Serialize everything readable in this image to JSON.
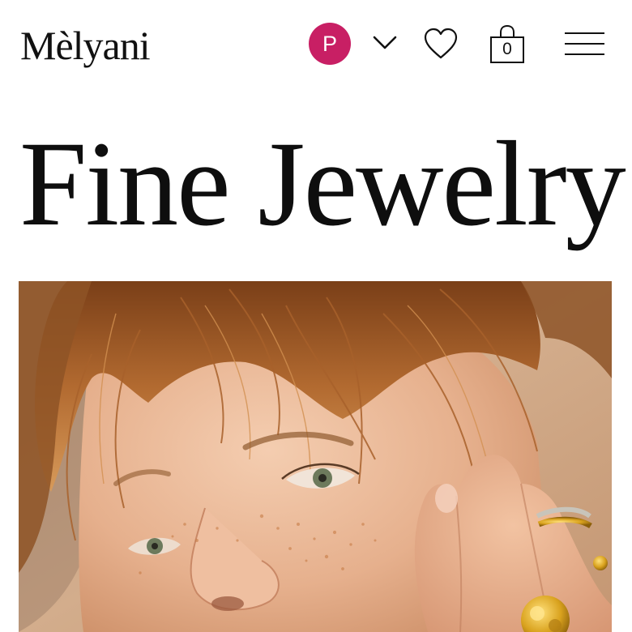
{
  "header": {
    "brand": "Mèlyani",
    "account": {
      "initial": "P",
      "avatar_color": "#c81f64",
      "menu_icon": "chevron-down-icon"
    },
    "wishlist_icon": "heart-icon",
    "cart": {
      "icon": "shopping-bag-icon",
      "count": "0"
    },
    "menu_icon": "hamburger-menu-icon"
  },
  "main": {
    "title": "Fine Jewelry",
    "hero": {
      "description_icon": "hero-photo",
      "palette": {
        "skin": "#e8b493",
        "hair": "#a9652f",
        "background": "#cfa685",
        "gold": "#d9a21e"
      }
    }
  }
}
